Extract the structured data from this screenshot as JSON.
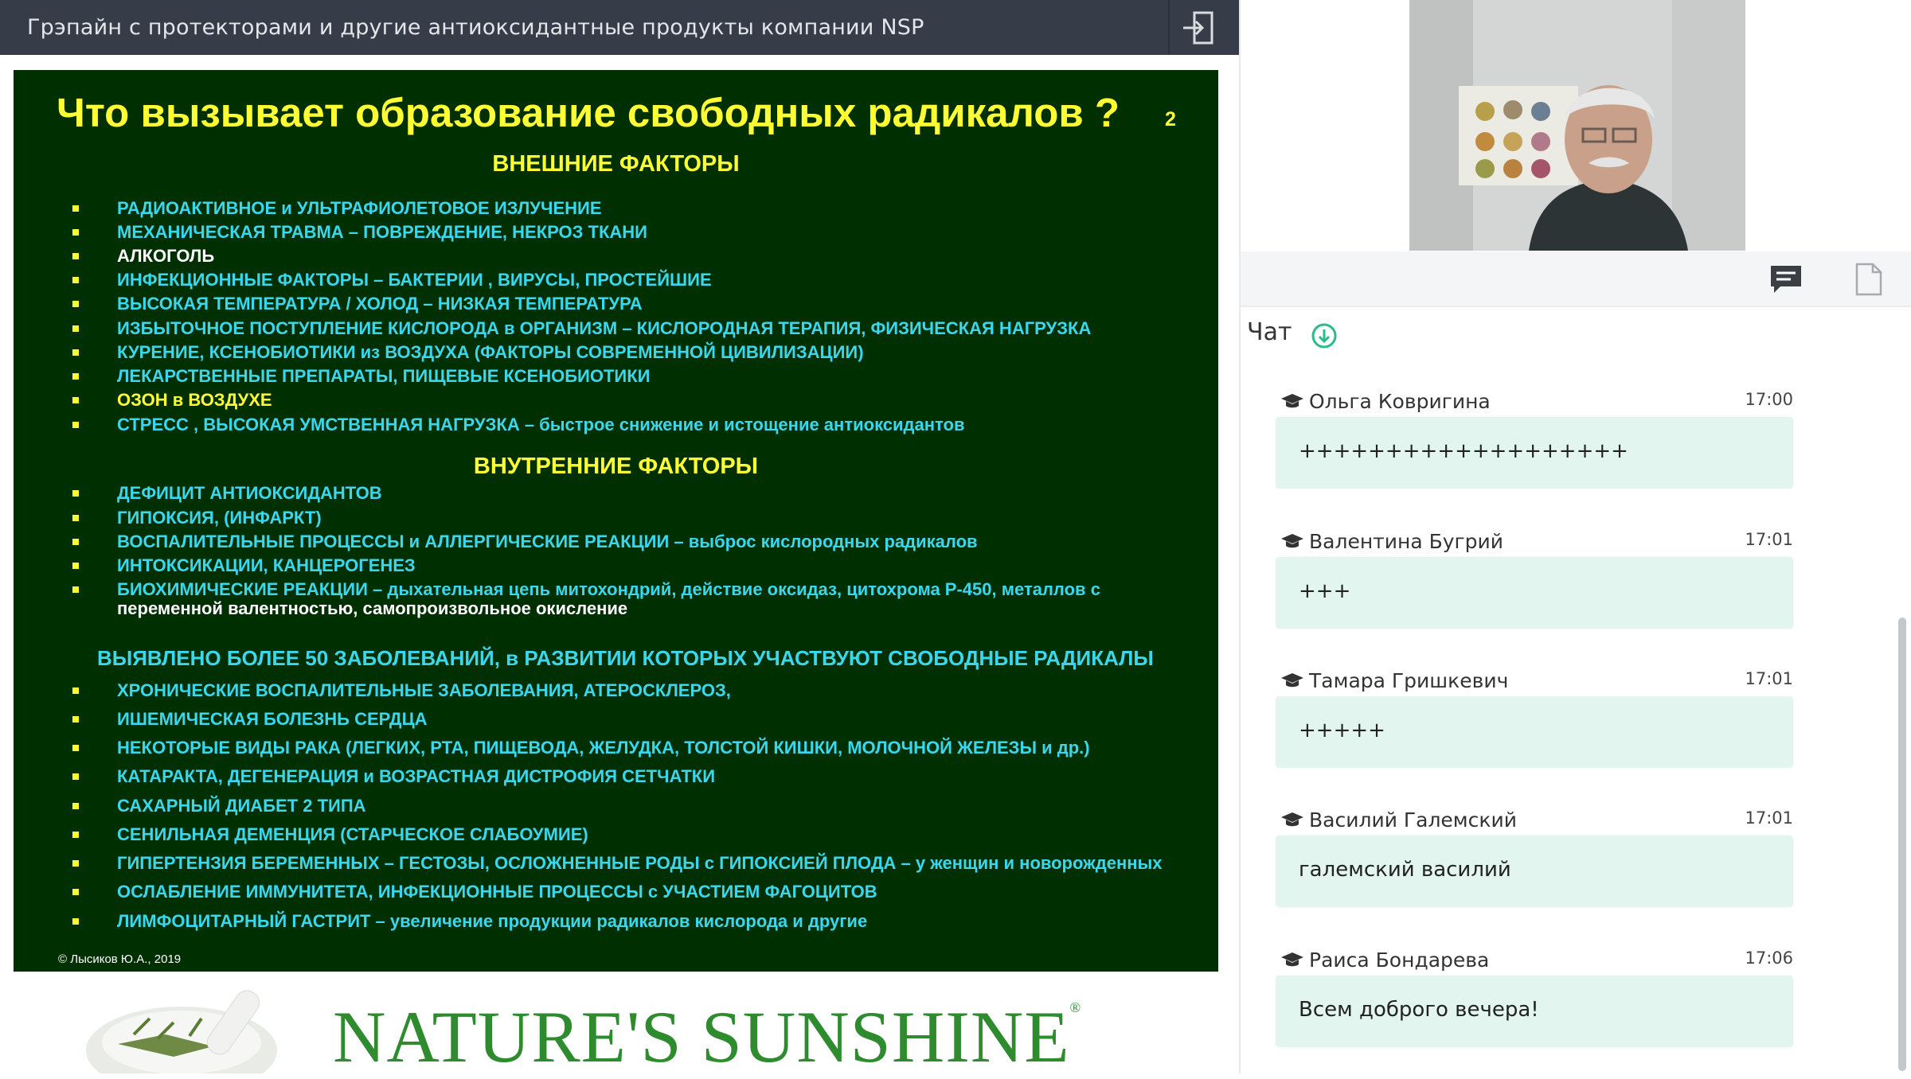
{
  "header": {
    "title": "Грэпайн с протекторами и другие антиоксидантные продукты компании NSP",
    "exit_icon": "exit-icon"
  },
  "slide": {
    "title": "Что вызывает образование  свободных радикалов ?",
    "page_number": "2",
    "external_heading": "ВНЕШНИЕ  ФАКТОРЫ",
    "internal_heading": "ВНУТРЕННИЕ  ФАКТОРЫ",
    "external": [
      "РАДИОАКТИВНОЕ и  УЛЬТРАФИОЛЕТОВОЕ  ИЗЛУЧЕНИЕ",
      "МЕХАНИЧЕСКАЯ  ТРАВМА – ПОВРЕЖДЕНИЕ,  НЕКРОЗ  ТКАНИ",
      "АЛКОГОЛЬ",
      "ИНФЕКЦИОННЫЕ  ФАКТОРЫ  – БАКТЕРИИ ,  ВИРУСЫ, ПРОСТЕЙШИЕ",
      "ВЫСОКАЯ  ТЕМПЕРАТУРА / ХОЛОД – НИЗКАЯ  ТЕМПЕРАТУРА",
      "ИЗБЫТОЧНОЕ  ПОСТУПЛЕНИЕ  КИСЛОРОДА  в  ОРГАНИЗМ –  КИСЛОРОДНАЯ  ТЕРАПИЯ,  ФИЗИЧЕСКАЯ НАГРУЗКА",
      "КУРЕНИЕ,  КСЕНОБИОТИКИ из ВОЗДУХА (ФАКТОРЫ  СОВРЕМЕННОЙ  ЦИВИЛИЗАЦИИ)",
      "ЛЕКАРСТВЕННЫЕ  ПРЕПАРАТЫ,  ПИЩЕВЫЕ КСЕНОБИОТИКИ",
      "ОЗОН в ВОЗДУХЕ",
      "СТРЕСС , ВЫСОКАЯ  УМСТВЕННАЯ НАГРУЗКА – быстрое снижение и истощение антиоксидантов"
    ],
    "internal": [
      "ДЕФИЦИТ  АНТИОКСИДАНТОВ",
      "ГИПОКСИЯ, (ИНФАРКТ)",
      "ВОСПАЛИТЕЛЬНЫЕ  ПРОЦЕССЫ и АЛЛЕРГИЧЕСКИЕ  РЕАКЦИИ – выброс кислородных радикалов",
      "ИНТОКСИКАЦИИ, КАНЦЕРОГЕНЕЗ",
      "БИОХИМИЧЕСКИЕ  РЕАКЦИИ – дыхательная цепь митохондрий, действие оксидаз, цитохрома Р-450, металлов с",
      "переменной валентностью, самопроизвольное окисление"
    ],
    "diseases_heading": "ВЫЯВЛЕНО  БОЛЕЕ  50  ЗАБОЛЕВАНИЙ, в РАЗВИТИИ  КОТОРЫХ  УЧАСТВУЮТ СВОБОДНЫЕ  РАДИКАЛЫ",
    "diseases": [
      "ХРОНИЧЕСКИЕ  ВОСПАЛИТЕЛЬНЫЕ  ЗАБОЛЕВАНИЯ, АТЕРОСКЛЕРОЗ,",
      "ИШЕМИЧЕСКАЯ  БОЛЕЗНЬ СЕРДЦА",
      "НЕКОТОРЫЕ  ВИДЫ  РАКА (ЛЕГКИХ, РТА, ПИЩЕВОДА, ЖЕЛУДКА, ТОЛСТОЙ  КИШКИ, МОЛОЧНОЙ ЖЕЛЕЗЫ и др.)",
      "КАТАРАКТА,  ДЕГЕНЕРАЦИЯ и ВОЗРАСТНАЯ  ДИСТРОФИЯ  СЕТЧАТКИ",
      "САХАРНЫЙ  ДИАБЕТ  2 ТИПА",
      "СЕНИЛЬНАЯ  ДЕМЕНЦИЯ  (СТАРЧЕСКОЕ  СЛАБОУМИЕ)",
      "ГИПЕРТЕНЗИЯ  БЕРЕМЕННЫХ – ГЕСТОЗЫ, ОСЛОЖНЕННЫЕ  РОДЫ с ГИПОКСИЕЙ ПЛОДА – у женщин и новорожденных",
      "ОСЛАБЛЕНИЕ  ИММУНИТЕТА, ИНФЕКЦИОННЫЕ ПРОЦЕССЫ с УЧАСТИЕМ ФАГОЦИТОВ",
      "ЛИМФОЦИТАРНЫЙ  ГАСТРИТ – увеличение продукции радикалов кислорода и другие"
    ],
    "copyright": "©  Лысиков Ю.А., 2019"
  },
  "logo": {
    "text": "NATURE'S SUNSHINE",
    "mark": "®"
  },
  "panel": {
    "chat_title": "Чат",
    "chat_icon": "chat-icon",
    "file_icon": "file-icon",
    "messages": [
      {
        "author": "Ольга Ковригина",
        "time": "17:00",
        "text": "+++++++++++++++++++"
      },
      {
        "author": "Валентина Бугрий",
        "time": "17:01",
        "text": "+++"
      },
      {
        "author": "Тамара Гришкевич",
        "time": "17:01",
        "text": "+++++"
      },
      {
        "author": "Василий Галемский",
        "time": "17:01",
        "text": "галемский василий"
      },
      {
        "author": "Раиса Бондарева",
        "time": "17:06",
        "text": "Всем доброго вечера!"
      }
    ]
  }
}
